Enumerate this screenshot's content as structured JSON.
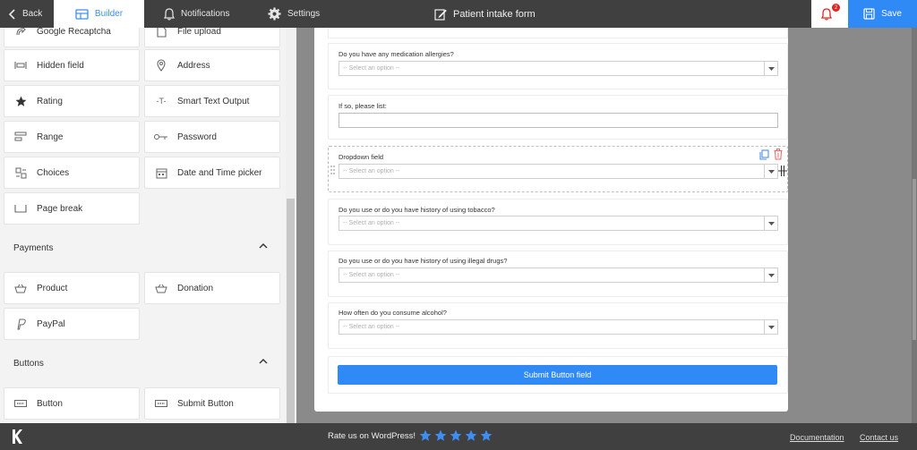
{
  "topbar": {
    "back_label": "Back",
    "builder_label": "Builder",
    "notifications_label": "Notifications",
    "settings_label": "Settings",
    "form_title": "Patient intake form",
    "notification_count": "2",
    "save_label": "Save"
  },
  "sidebar": {
    "fields_top": [
      {
        "label": "Google Recaptcha",
        "icon": "recaptcha-icon"
      },
      {
        "label": "File upload",
        "icon": "file-upload-icon"
      },
      {
        "label": "Hidden field",
        "icon": "hidden-field-icon"
      },
      {
        "label": "Address",
        "icon": "location-pin-icon"
      },
      {
        "label": "Rating",
        "icon": "star-icon"
      },
      {
        "label": "Smart Text Output",
        "icon": "text-output-icon"
      },
      {
        "label": "Range",
        "icon": "range-icon"
      },
      {
        "label": "Password",
        "icon": "key-icon"
      },
      {
        "label": "Choices",
        "icon": "choices-icon"
      },
      {
        "label": "Date and Time picker",
        "icon": "calendar-icon"
      },
      {
        "label": "Page break",
        "icon": "page-break-icon"
      }
    ],
    "payments_title": "Payments",
    "payments": [
      {
        "label": "Product",
        "icon": "basket-icon"
      },
      {
        "label": "Donation",
        "icon": "donation-basket-icon"
      },
      {
        "label": "PayPal",
        "icon": "paypal-icon"
      }
    ],
    "buttons_title": "Buttons",
    "buttons": [
      {
        "label": "Button",
        "icon": "button-icon"
      },
      {
        "label": "Submit Button",
        "icon": "submit-button-icon"
      }
    ]
  },
  "form": {
    "fields": [
      {
        "label": "Do you have any medication allergies?",
        "placeholder": "-- Select an option --",
        "type": "select"
      },
      {
        "label": "If so, please list:",
        "type": "text"
      },
      {
        "label": "Dropdown field",
        "placeholder": "-- Select an option --",
        "type": "select"
      },
      {
        "label": "Do you use or do you have history of using tobacco?",
        "placeholder": "-- Select an option --",
        "type": "select"
      },
      {
        "label": "Do you use or do you have history of using illegal drugs?",
        "placeholder": "-- Select an option --",
        "type": "select"
      },
      {
        "label": "How often do you consume alcohol?",
        "placeholder": "-- Select an option --",
        "type": "select"
      }
    ],
    "submit_label": "Submit Button field"
  },
  "footer": {
    "rate_label": "Rate us on WordPress!",
    "stars": 5,
    "documentation_label": "Documentation",
    "contact_label": "Contact us"
  },
  "colors": {
    "accent": "#2f8af5",
    "dark_bar": "#404040",
    "badge": "#e02424"
  }
}
